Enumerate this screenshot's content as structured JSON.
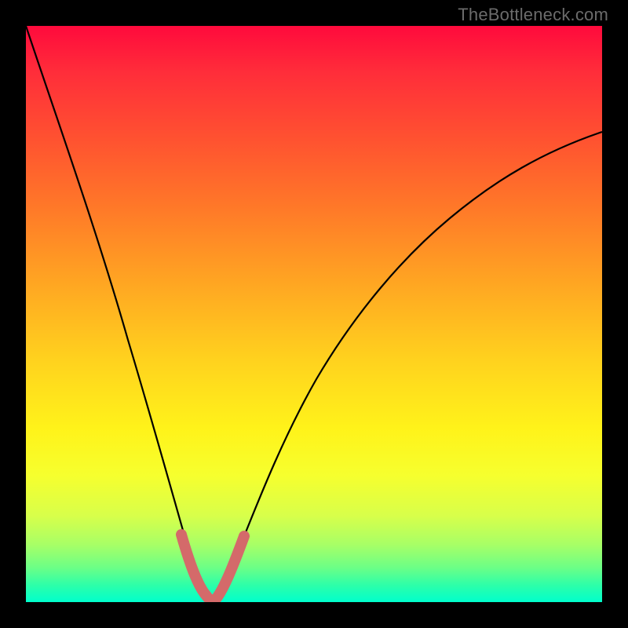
{
  "watermark": "TheBottleneck.com",
  "chart_data": {
    "type": "line",
    "title": "",
    "xlabel": "",
    "ylabel": "",
    "xlim": [
      0,
      100
    ],
    "ylim": [
      0,
      100
    ],
    "grid": false,
    "legend": false,
    "background": {
      "style": "vertical-gradient",
      "stops": [
        {
          "pos": 0,
          "color": "#ff0a3c"
        },
        {
          "pos": 20,
          "color": "#ff5330"
        },
        {
          "pos": 45,
          "color": "#ffa722"
        },
        {
          "pos": 70,
          "color": "#fff31a"
        },
        {
          "pos": 90,
          "color": "#a8ff66"
        },
        {
          "pos": 100,
          "color": "#00ffcc"
        }
      ]
    },
    "series": [
      {
        "name": "bottleneck-curve",
        "stroke": "#000000",
        "stroke_width": 2,
        "x": [
          0,
          4,
          8,
          12,
          16,
          20,
          23,
          26,
          28,
          30,
          32,
          34,
          37,
          40,
          44,
          48,
          54,
          60,
          68,
          76,
          84,
          92,
          100
        ],
        "y": [
          100,
          84,
          68,
          54,
          42,
          30,
          20,
          12,
          6,
          2,
          0.5,
          2,
          6,
          12,
          20,
          28,
          38,
          46,
          55,
          62,
          68,
          73,
          78
        ]
      },
      {
        "name": "trough-highlight",
        "stroke": "#d46a6a",
        "stroke_width": 10,
        "linecap": "round",
        "x": [
          26,
          28,
          30,
          32,
          34,
          37
        ],
        "y": [
          12,
          6,
          2,
          0.5,
          2,
          6
        ]
      }
    ],
    "minimum": {
      "x": 32,
      "y": 0.5
    }
  }
}
